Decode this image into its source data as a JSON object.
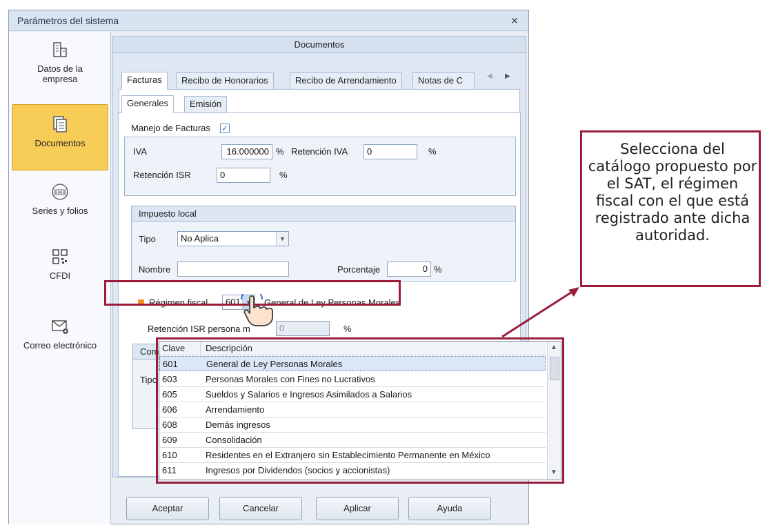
{
  "window": {
    "title": "Parámetros del sistema",
    "close_glyph": "✕"
  },
  "sidebar": {
    "items": [
      {
        "label_line1": "Datos de la",
        "label_line2": "empresa",
        "icon": "building-icon"
      },
      {
        "label": "Documentos",
        "icon": "documents-icon",
        "active": true
      },
      {
        "label": "Series y folios",
        "icon": "counter-icon"
      },
      {
        "label": "CFDI",
        "icon": "qr-code-icon"
      },
      {
        "label": "Correo electrónico",
        "icon": "mail-settings-icon"
      }
    ]
  },
  "main": {
    "group_title": "Documentos",
    "tabs": [
      "Facturas",
      "Recibo de Honorarios",
      "Recibo de Arrendamiento",
      "Notas de C"
    ],
    "subtabs": [
      "Generales",
      "Emisión"
    ],
    "manejo_label": "Manejo de Facturas",
    "manejo_checked": "✓",
    "iva_label": "IVA",
    "iva_value": "16.000000",
    "pct": "%",
    "ret_iva_label": "Retención IVA",
    "ret_iva_value": "0",
    "ret_isr_label": "Retención ISR",
    "ret_isr_value": "0",
    "impuesto_local_title": "Impuesto local",
    "tipo_label": "Tipo",
    "tipo_value": "No Aplica",
    "nombre_label": "Nombre",
    "nombre_value": "",
    "porcentaje_label": "Porcentaje",
    "porcentaje_value": "0",
    "regimen_label": "Régimen fiscal",
    "regimen_code": "601",
    "regimen_desc": "General de Ley Personas Morales",
    "ret_isr_pm_label": "Retención ISR persona m",
    "ret_isr_pm_value": "0",
    "hidden_group_title": "Com",
    "hidden_tipo": "Tipo"
  },
  "regimen_list": {
    "headers": [
      "Clave",
      "Descripción"
    ],
    "rows": [
      {
        "clave": "601",
        "desc": "General de Ley Personas Morales"
      },
      {
        "clave": "603",
        "desc": "Personas Morales con Fines no Lucrativos"
      },
      {
        "clave": "605",
        "desc": "Sueldos y Salarios e Ingresos Asimilados a Salarios"
      },
      {
        "clave": "606",
        "desc": "Arrendamiento"
      },
      {
        "clave": "608",
        "desc": "Demás ingresos"
      },
      {
        "clave": "609",
        "desc": "Consolidación"
      },
      {
        "clave": "610",
        "desc": "Residentes en el Extranjero sin Establecimiento Permanente en México"
      },
      {
        "clave": "611",
        "desc": "Ingresos por Dividendos (socios y accionistas)"
      }
    ]
  },
  "buttons": [
    "Aceptar",
    "Cancelar",
    "Aplicar",
    "Ayuda"
  ],
  "annotation": "Selecciona del catálogo propuesto por el SAT, el régimen fiscal con el que está registrado ante dicha autoridad.",
  "colors": {
    "highlight": "#9b1d3b",
    "active_sidebar": "#f8cd57",
    "regimen_marker": "#f0921c"
  }
}
